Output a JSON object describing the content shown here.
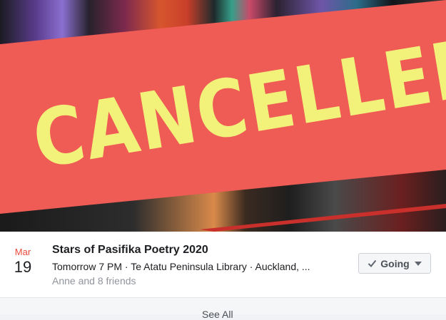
{
  "cover": {
    "banner_text": "CANCELLED"
  },
  "event": {
    "month": "Mar",
    "day": "19",
    "title": "Stars of Pasifika Poetry 2020",
    "details": "Tomorrow 7 PM · Te Atatu Peninsula Library · Auckland, ...",
    "friends": "Anne and 8 friends"
  },
  "rsvp": {
    "label": "Going",
    "icons": {
      "check": "check-icon",
      "caret": "caret-down-icon"
    }
  },
  "footer": {
    "see_all_label": "See All"
  },
  "colors": {
    "banner": "#ef5b55",
    "banner_text": "#f2f27a",
    "month": "#e94b3c"
  }
}
